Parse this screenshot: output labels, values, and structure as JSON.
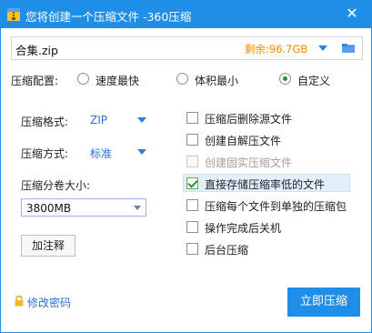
{
  "window": {
    "title": "您将创建一个压缩文件 -360压缩",
    "close_glyph": "✕"
  },
  "file": {
    "name": "合集.zip",
    "space_label": "剩余:96.7GB"
  },
  "config": {
    "label": "压缩配置:",
    "options": [
      {
        "label": "速度最快",
        "selected": false
      },
      {
        "label": "体积最小",
        "selected": false
      },
      {
        "label": "自定义",
        "selected": true
      }
    ]
  },
  "format": {
    "label": "压缩格式:",
    "value": "ZIP"
  },
  "method": {
    "label": "压缩方式:",
    "value": "标准"
  },
  "split": {
    "label": "压缩分卷大小:",
    "value": "3800MB"
  },
  "comment_button": "加注释",
  "options": [
    {
      "label": "压缩后删除源文件",
      "checked": false,
      "disabled": false
    },
    {
      "label": "创建自解压文件",
      "checked": false,
      "disabled": false
    },
    {
      "label": "创建固实压缩文件",
      "checked": false,
      "disabled": true
    },
    {
      "label": "直接存储压缩率低的文件",
      "checked": true,
      "disabled": false
    },
    {
      "label": "压缩每个文件到单独的压缩包",
      "checked": false,
      "disabled": false
    },
    {
      "label": "操作完成后关机",
      "checked": false,
      "disabled": false
    },
    {
      "label": "后台压缩",
      "checked": false,
      "disabled": false
    }
  ],
  "password_link": "修改密码",
  "primary_button": "立即压缩",
  "icons": {
    "title": "archive-app-icon",
    "close": "close-icon",
    "folder": "folder-icon",
    "lock": "lock-icon",
    "dropdown": "chevron-down-icon"
  },
  "colors": {
    "accent": "#1f8ee6",
    "link": "#2f6fd0",
    "space": "#f08a00",
    "check": "#2a8f3a"
  }
}
